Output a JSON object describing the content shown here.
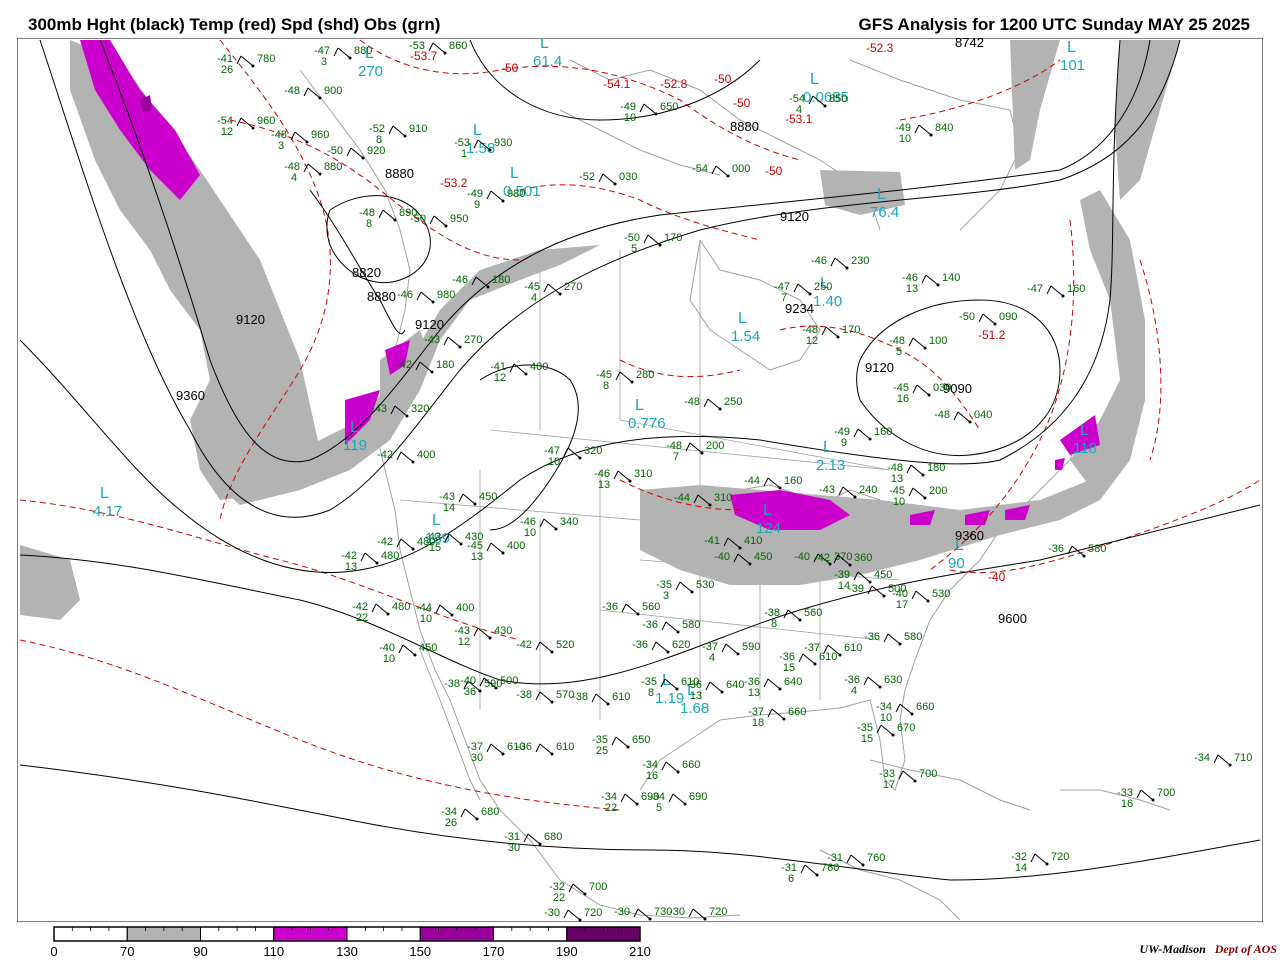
{
  "header": {
    "title_left": "300mb Hght (black) Temp (red) Spd (shd) Obs (grn)",
    "title_right": "GFS Analysis for 1200 UTC Sunday  MAY 25 2025"
  },
  "footer": {
    "credit_org": "UW-Madison",
    "credit_dept": "Dept of AOS"
  },
  "colors": {
    "height_contour": "#000000",
    "temperature_contour": "#cc0000",
    "obs_text": "#006600",
    "low_center": "#1aa7b8",
    "speed_70_90": "#b3b3b3",
    "speed_110_130": "#cc00cc",
    "speed_150_170": "#990099",
    "speed_190_210": "#660066",
    "geography": "#a0a0a0"
  },
  "speed_legend": {
    "ticks": [
      "0",
      "70",
      "90",
      "110",
      "130",
      "150",
      "170",
      "190",
      "210"
    ],
    "bands": [
      "#ffffff",
      "#b3b3b3",
      "#ffffff",
      "#cc00cc",
      "#ffffff",
      "#990099",
      "#ffffff",
      "#660066"
    ]
  },
  "height_labels": [
    "8742",
    "8880",
    "8880",
    "8820",
    "8880",
    "9120",
    "9120",
    "9120",
    "9234",
    "9120",
    "9360",
    "9360",
    "9600",
    "9090"
  ],
  "temperature_labels": [
    "-50",
    "-53.7",
    "-54.1",
    "-52.3",
    "-52.8",
    "-50",
    "-50",
    "-53.1",
    "-50",
    "-53.2",
    "-51.2",
    "-40"
  ],
  "low_centers": [
    {
      "symbol": "L",
      "value": "61.4"
    },
    {
      "symbol": "L",
      "value": "270"
    },
    {
      "symbol": "L",
      "value": "0.0685"
    },
    {
      "symbol": "L",
      "value": "101"
    },
    {
      "symbol": "L",
      "value": "1.58"
    },
    {
      "symbol": "L",
      "value": "0.501"
    },
    {
      "symbol": "L",
      "value": "76.4"
    },
    {
      "symbol": "L",
      "value": "1.40"
    },
    {
      "symbol": "L",
      "value": "1.54"
    },
    {
      "symbol": "L",
      "value": "0.776"
    },
    {
      "symbol": "L",
      "value": "2.13"
    },
    {
      "symbol": "L",
      "value": "119"
    },
    {
      "symbol": "L",
      "value": "118"
    },
    {
      "symbol": "L",
      "value": "124"
    },
    {
      "symbol": "L",
      "value": "90"
    },
    {
      "symbol": "L",
      "value": "4.17"
    },
    {
      "symbol": "L",
      "value": "189"
    },
    {
      "symbol": "L",
      "value": "1.19"
    },
    {
      "symbol": "L",
      "value": "1.68"
    }
  ],
  "observations": [
    {
      "t": "-41",
      "h": "780",
      "s": "26"
    },
    {
      "t": "-47",
      "h": "880",
      "s": "3"
    },
    {
      "t": "-53",
      "h": "860",
      "s": ""
    },
    {
      "t": "-48",
      "h": "900",
      "s": ""
    },
    {
      "t": "-54",
      "h": "960",
      "s": "12"
    },
    {
      "t": "-48",
      "h": "960",
      "s": "3"
    },
    {
      "t": "-50",
      "h": "920",
      "s": ""
    },
    {
      "t": "-48",
      "h": "880",
      "s": "4"
    },
    {
      "t": "-52",
      "h": "910",
      "s": "8"
    },
    {
      "t": "-53",
      "h": "930",
      "s": "1"
    },
    {
      "t": "-49",
      "h": "650",
      "s": "10"
    },
    {
      "t": "-54",
      "h": "850",
      "s": "4"
    },
    {
      "t": "-49",
      "h": "840",
      "s": "10"
    },
    {
      "t": "-48",
      "h": "890",
      "s": "8"
    },
    {
      "t": "-50",
      "h": "950",
      "s": ""
    },
    {
      "t": "-49",
      "h": "980",
      "s": "9"
    },
    {
      "t": "-52",
      "h": "030",
      "s": ""
    },
    {
      "t": "-54",
      "h": "000",
      "s": ""
    },
    {
      "t": "-50",
      "h": "170",
      "s": "5"
    },
    {
      "t": "-46",
      "h": "230",
      "s": ""
    },
    {
      "t": "-47",
      "h": "250",
      "s": "7"
    },
    {
      "t": "-46",
      "h": "140",
      "s": "13"
    },
    {
      "t": "-47",
      "h": "160",
      "s": ""
    },
    {
      "t": "-46",
      "h": "180",
      "s": ""
    },
    {
      "t": "-46",
      "h": "980",
      "s": ""
    },
    {
      "t": "-45",
      "h": "270",
      "s": "4"
    },
    {
      "t": "-43",
      "h": "270",
      "s": ""
    },
    {
      "t": "-42",
      "h": "180",
      "s": ""
    },
    {
      "t": "-41",
      "h": "400",
      "s": "12"
    },
    {
      "t": "-45",
      "h": "280",
      "s": "8"
    },
    {
      "t": "-48",
      "h": "170",
      "s": "12"
    },
    {
      "t": "-48",
      "h": "100",
      "s": "5"
    },
    {
      "t": "-50",
      "h": "090",
      "s": ""
    },
    {
      "t": "-45",
      "h": "030",
      "s": "16"
    },
    {
      "t": "-48",
      "h": "040",
      "s": ""
    },
    {
      "t": "-43",
      "h": "320",
      "s": ""
    },
    {
      "t": "-48",
      "h": "250",
      "s": ""
    },
    {
      "t": "-48",
      "h": "200",
      "s": "7"
    },
    {
      "t": "-47",
      "h": "320",
      "s": "10"
    },
    {
      "t": "-49",
      "h": "160",
      "s": "9"
    },
    {
      "t": "-42",
      "h": "400",
      "s": ""
    },
    {
      "t": "-46",
      "h": "310",
      "s": "13"
    },
    {
      "t": "-43",
      "h": "450",
      "s": "14"
    },
    {
      "t": "-44",
      "h": "310",
      "s": ""
    },
    {
      "t": "-44",
      "h": "160",
      "s": ""
    },
    {
      "t": "-43",
      "h": "240",
      "s": ""
    },
    {
      "t": "-45",
      "h": "200",
      "s": "10"
    },
    {
      "t": "-48",
      "h": "180",
      "s": "13"
    },
    {
      "t": "-46",
      "h": "340",
      "s": "10"
    },
    {
      "t": "-42",
      "h": "480",
      "s": ""
    },
    {
      "t": "-43",
      "h": "430",
      "s": "15"
    },
    {
      "t": "-45",
      "h": "400",
      "s": "13"
    },
    {
      "t": "-41",
      "h": "410",
      "s": ""
    },
    {
      "t": "-40",
      "h": "450",
      "s": ""
    },
    {
      "t": "-40",
      "h": "370",
      "s": ""
    },
    {
      "t": "-42",
      "h": "360",
      "s": ""
    },
    {
      "t": "-42",
      "h": "480",
      "s": "13"
    },
    {
      "t": "-42",
      "h": "480",
      "s": "22"
    },
    {
      "t": "-44",
      "h": "400",
      "s": "10"
    },
    {
      "t": "-43",
      "h": "430",
      "s": "12"
    },
    {
      "t": "-40",
      "h": "450",
      "s": "10"
    },
    {
      "t": "-35",
      "h": "530",
      "s": "3"
    },
    {
      "t": "-36",
      "h": "560",
      "s": ""
    },
    {
      "t": "-38",
      "h": "560",
      "s": "8"
    },
    {
      "t": "-39",
      "h": "450",
      "s": "14"
    },
    {
      "t": "-39",
      "h": "500",
      "s": ""
    },
    {
      "t": "-40",
      "h": "530",
      "s": "17"
    },
    {
      "t": "-36",
      "h": "580",
      "s": ""
    },
    {
      "t": "-36",
      "h": "580",
      "s": ""
    },
    {
      "t": "-42",
      "h": "520",
      "s": ""
    },
    {
      "t": "-36",
      "h": "620",
      "s": ""
    },
    {
      "t": "-37",
      "h": "590",
      "s": "4"
    },
    {
      "t": "-36",
      "h": "610",
      "s": "15"
    },
    {
      "t": "-37",
      "h": "610",
      "s": ""
    },
    {
      "t": "-38",
      "h": "590",
      "s": ""
    },
    {
      "t": "-40",
      "h": "500",
      "s": "36"
    },
    {
      "t": "-38",
      "h": "570",
      "s": ""
    },
    {
      "t": "-38",
      "h": "610",
      "s": ""
    },
    {
      "t": "-35",
      "h": "610",
      "s": "8"
    },
    {
      "t": "-36",
      "h": "640",
      "s": "13"
    },
    {
      "t": "-36",
      "h": "640",
      "s": "13"
    },
    {
      "t": "-37",
      "h": "660",
      "s": "18"
    },
    {
      "t": "-36",
      "h": "630",
      "s": "4"
    },
    {
      "t": "-34",
      "h": "660",
      "s": "10"
    },
    {
      "t": "-35",
      "h": "670",
      "s": "15"
    },
    {
      "t": "-37",
      "h": "610",
      "s": "30"
    },
    {
      "t": "-36",
      "h": "610",
      "s": ""
    },
    {
      "t": "-35",
      "h": "650",
      "s": "25"
    },
    {
      "t": "-34",
      "h": "660",
      "s": "16"
    },
    {
      "t": "-33",
      "h": "700",
      "s": "17"
    },
    {
      "t": "-34",
      "h": "680",
      "s": "26"
    },
    {
      "t": "-34",
      "h": "690",
      "s": "22"
    },
    {
      "t": "-34",
      "h": "690",
      "s": "5"
    },
    {
      "t": "-31",
      "h": "680",
      "s": "30"
    },
    {
      "t": "-32",
      "h": "700",
      "s": "22"
    },
    {
      "t": "-30",
      "h": "720",
      "s": ""
    },
    {
      "t": "-30",
      "h": "730",
      "s": ""
    },
    {
      "t": "-30",
      "h": "720",
      "s": ""
    },
    {
      "t": "-31",
      "h": "760",
      "s": "6"
    },
    {
      "t": "-31",
      "h": "760",
      "s": ""
    },
    {
      "t": "-32",
      "h": "720",
      "s": "14"
    },
    {
      "t": "-33",
      "h": "700",
      "s": "16"
    },
    {
      "t": "-34",
      "h": "710",
      "s": ""
    },
    {
      "t": "-36",
      "h": "580",
      "s": ""
    }
  ]
}
